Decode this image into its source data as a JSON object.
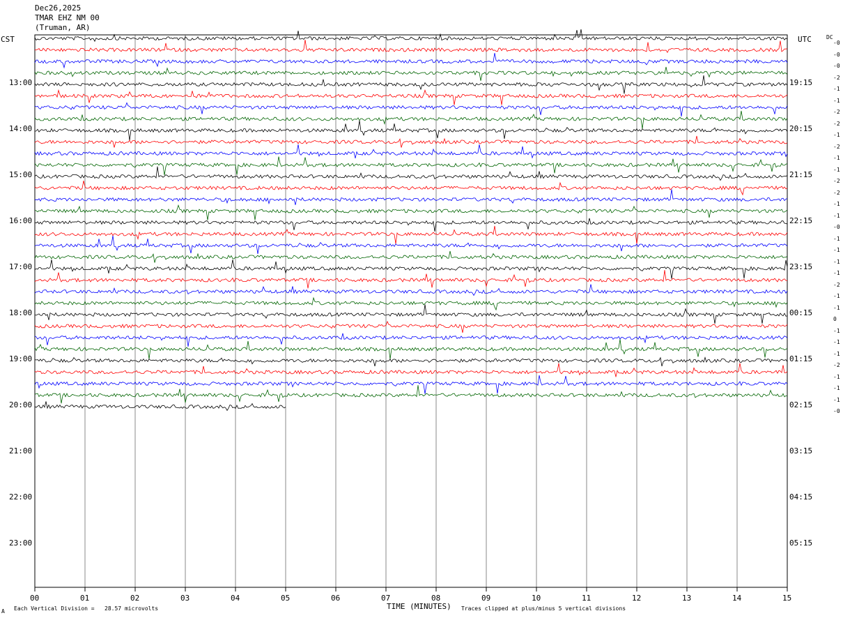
{
  "header": {
    "date": "Dec26,2025",
    "station": "TMAR EHZ NM 00",
    "location": "(Truman, AR)"
  },
  "left_axis_label": "CST",
  "right_axis_label": "UTC",
  "dc_label": "DC",
  "footer": {
    "vertical_division": "Each Vertical Division =   28.57 microvolts",
    "xlabel": "TIME (MINUTES)",
    "clip_note": "Traces clipped at plus/minus 5 vertical divisions",
    "corner_mark": "A"
  },
  "chart_data": {
    "type": "line",
    "title": "Dec26,2025 TMAR EHZ NM 00 (Truman, AR)",
    "xlabel": "TIME (MINUTES)",
    "ylabel": "CST",
    "xlim": [
      0,
      15
    ],
    "x_ticks": [
      "00",
      "01",
      "02",
      "03",
      "04",
      "05",
      "06",
      "07",
      "08",
      "09",
      "10",
      "11",
      "12",
      "13",
      "14",
      "15"
    ],
    "cst_ticks": [
      "13:00",
      "14:00",
      "15:00",
      "16:00",
      "17:00",
      "18:00",
      "19:00",
      "20:00",
      "21:00",
      "22:00",
      "23:00"
    ],
    "utc_ticks": [
      "19:15",
      "20:15",
      "21:15",
      "22:15",
      "23:15",
      "00:15",
      "01:15",
      "02:15",
      "03:15",
      "04:15",
      "05:15"
    ],
    "trace_colors": [
      "#000000",
      "#ff0000",
      "#0000ff",
      "#006400"
    ],
    "trace_count": 33,
    "last_trace_end_minute": 5,
    "dc_offsets": [
      "-0",
      "-0",
      "-0",
      "-2",
      "-1",
      "-1",
      "-2",
      "-2",
      "-1",
      "-2",
      "-1",
      "-1",
      "-2",
      "-2",
      "-1",
      "-1",
      "-0",
      "-1",
      "-1",
      "-1",
      "-1",
      "-2",
      "-1",
      "-1",
      "0",
      "-1",
      "-1",
      "-1",
      "-2",
      "-1",
      "-1",
      "-1",
      "-0"
    ],
    "grid": true
  }
}
